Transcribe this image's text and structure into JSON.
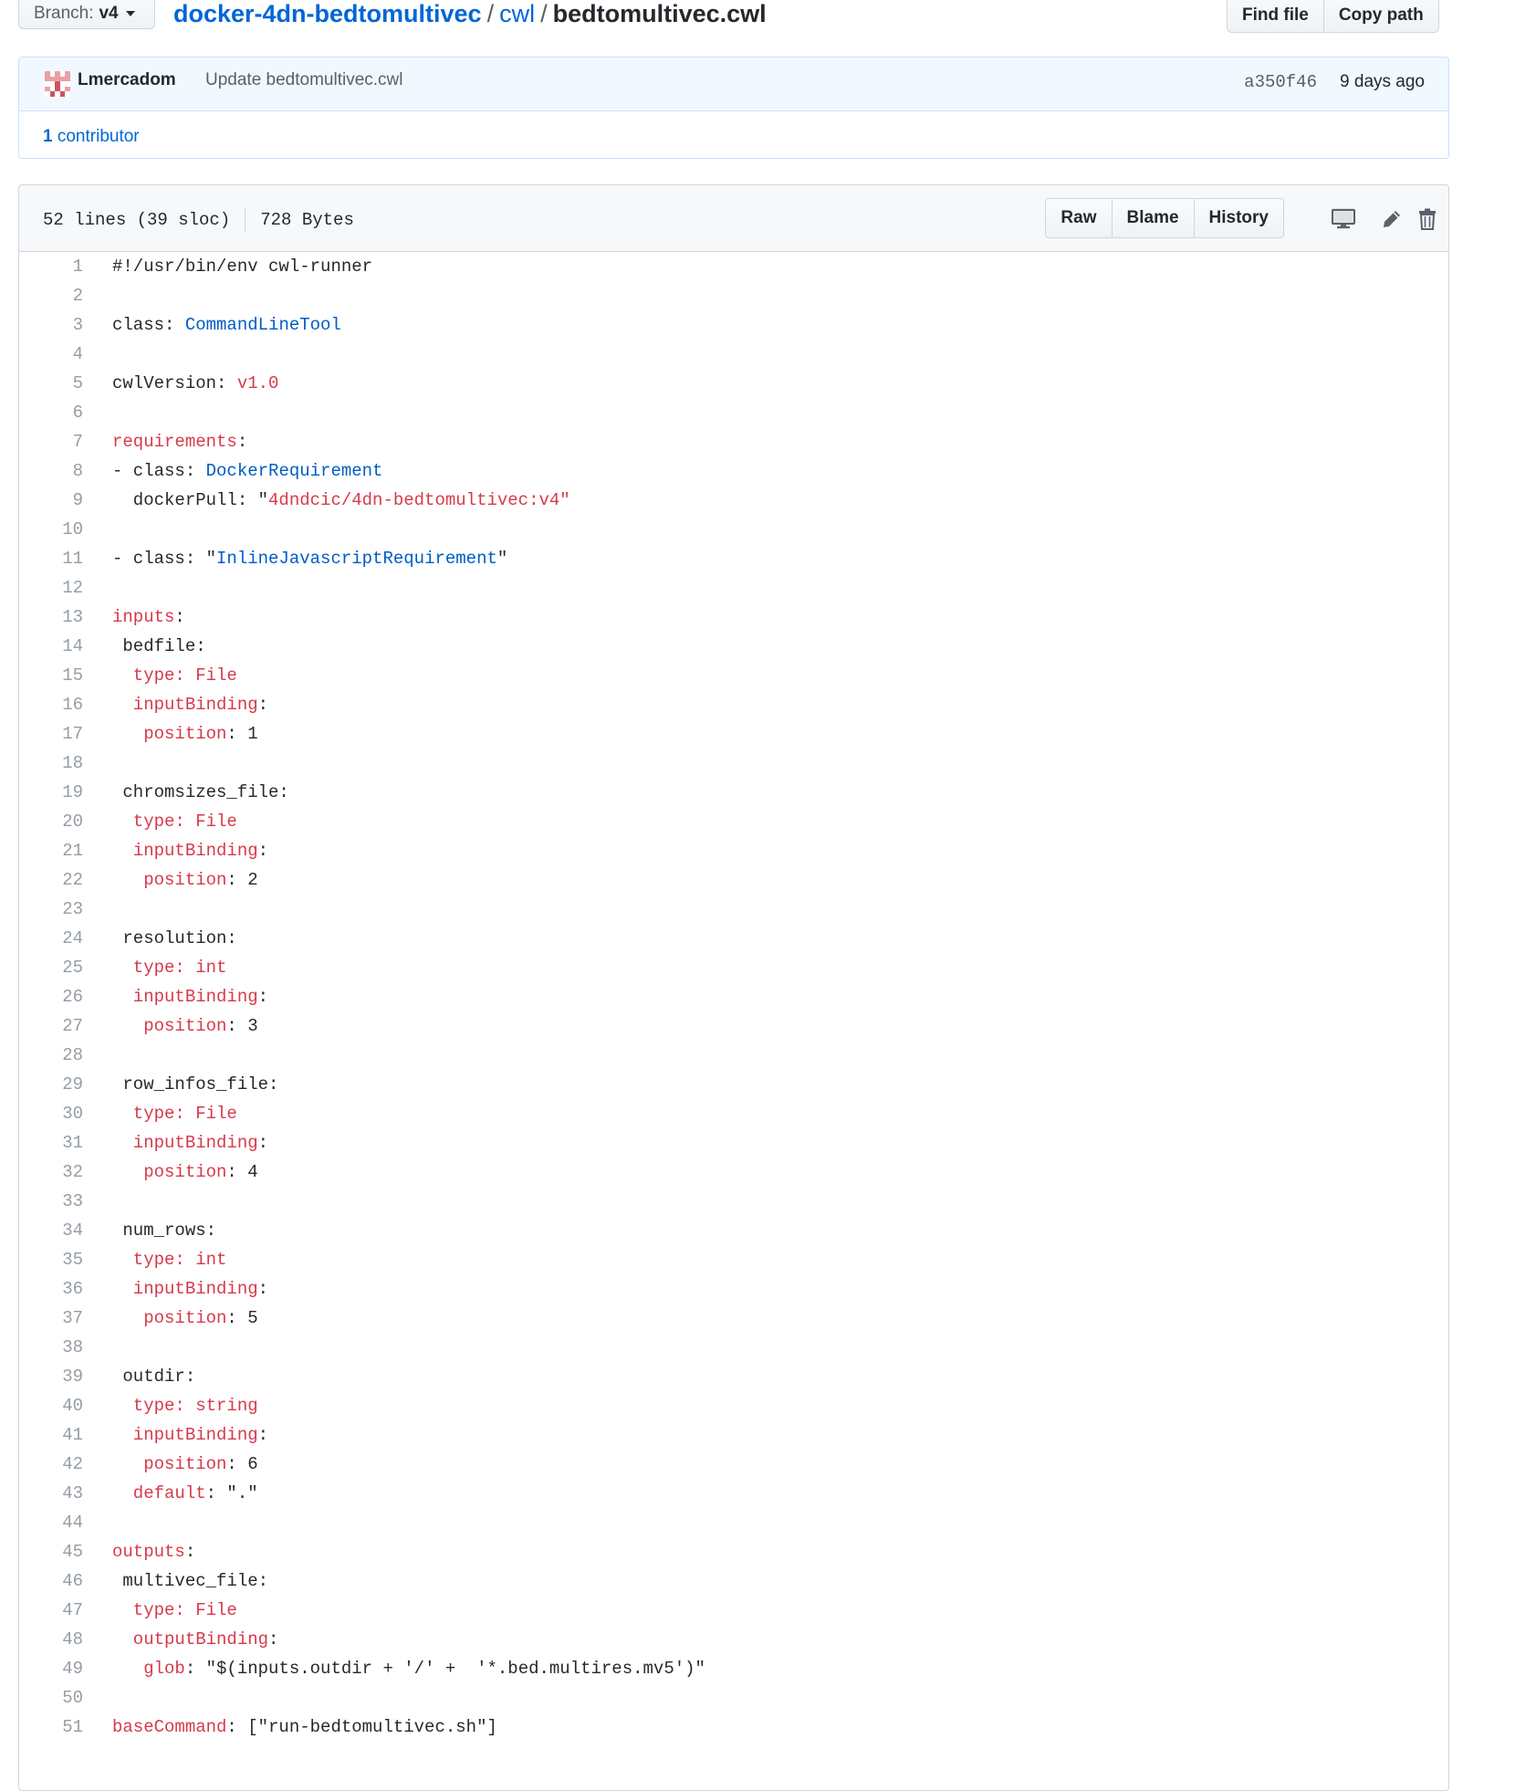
{
  "branch": {
    "label": "Branch:",
    "value": "v4"
  },
  "breadcrumb": {
    "repo": "docker-4dn-bedtomultivec",
    "sep": "/",
    "dir": "cwl",
    "file": "bedtomultivec.cwl"
  },
  "file_nav": {
    "find_file": "Find file",
    "copy_path": "Copy path"
  },
  "commit": {
    "author": "Lmercadom",
    "message": "Update bedtomultivec.cwl",
    "sha": "a350f46",
    "time": "9 days ago"
  },
  "contributors": {
    "count": "1",
    "label": "contributor"
  },
  "file_info": {
    "lines": "52 lines (39 sloc)",
    "size": "728 Bytes"
  },
  "file_actions": {
    "raw": "Raw",
    "blame": "Blame",
    "history": "History"
  },
  "icons": {
    "display": "desktop-icon",
    "edit": "pencil-icon",
    "delete": "trash-icon"
  },
  "colors": {
    "link": "#0366d6",
    "keyword": "#d73a49",
    "constant": "#005cc5",
    "line_number": "#959da5"
  },
  "code_lines": [
    [
      [
        "n",
        "#!/usr/bin/env cwl-runner"
      ]
    ],
    [],
    [
      [
        "n",
        "class: "
      ],
      [
        "c",
        "CommandLineTool"
      ]
    ],
    [],
    [
      [
        "n",
        "cwlVersion: "
      ],
      [
        "s",
        "v1.0"
      ]
    ],
    [],
    [
      [
        "k",
        "requirements"
      ],
      [
        "n",
        ":"
      ]
    ],
    [
      [
        "n",
        "- class: "
      ],
      [
        "c",
        "DockerRequirement"
      ]
    ],
    [
      [
        "n",
        "  dockerPull: \""
      ],
      [
        "s",
        "4dndcic/4dn-bedtomultivec:v4"
      ],
      [
        "s",
        "\""
      ]
    ],
    [],
    [
      [
        "n",
        "- class: \""
      ],
      [
        "c",
        "InlineJavascriptRequirement"
      ],
      [
        "n",
        "\""
      ]
    ],
    [],
    [
      [
        "k",
        "inputs"
      ],
      [
        "n",
        ":"
      ]
    ],
    [
      [
        "n",
        " bedfile:"
      ]
    ],
    [
      [
        "k",
        "  type: File"
      ]
    ],
    [
      [
        "k",
        "  inputBinding"
      ],
      [
        "n",
        ":"
      ]
    ],
    [
      [
        "k",
        "   position"
      ],
      [
        "n",
        ": 1"
      ]
    ],
    [],
    [
      [
        "n",
        " chromsizes_file:"
      ]
    ],
    [
      [
        "k",
        "  type: File"
      ]
    ],
    [
      [
        "k",
        "  inputBinding"
      ],
      [
        "n",
        ":"
      ]
    ],
    [
      [
        "k",
        "   position"
      ],
      [
        "n",
        ": 2"
      ]
    ],
    [],
    [
      [
        "n",
        " resolution:"
      ]
    ],
    [
      [
        "k",
        "  type: int"
      ]
    ],
    [
      [
        "k",
        "  inputBinding"
      ],
      [
        "n",
        ":"
      ]
    ],
    [
      [
        "k",
        "   position"
      ],
      [
        "n",
        ": 3"
      ]
    ],
    [],
    [
      [
        "n",
        " row_infos_file:"
      ]
    ],
    [
      [
        "k",
        "  type: File"
      ]
    ],
    [
      [
        "k",
        "  inputBinding"
      ],
      [
        "n",
        ":"
      ]
    ],
    [
      [
        "k",
        "   position"
      ],
      [
        "n",
        ": 4"
      ]
    ],
    [],
    [
      [
        "n",
        " num_rows:"
      ]
    ],
    [
      [
        "k",
        "  type: int"
      ]
    ],
    [
      [
        "k",
        "  inputBinding"
      ],
      [
        "n",
        ":"
      ]
    ],
    [
      [
        "k",
        "   position"
      ],
      [
        "n",
        ": 5"
      ]
    ],
    [],
    [
      [
        "n",
        " outdir:"
      ]
    ],
    [
      [
        "k",
        "  type: string"
      ]
    ],
    [
      [
        "k",
        "  inputBinding"
      ],
      [
        "n",
        ":"
      ]
    ],
    [
      [
        "k",
        "   position"
      ],
      [
        "n",
        ": 6"
      ]
    ],
    [
      [
        "k",
        "  default"
      ],
      [
        "n",
        ": \".\""
      ]
    ],
    [],
    [
      [
        "k",
        "outputs"
      ],
      [
        "n",
        ":"
      ]
    ],
    [
      [
        "n",
        " multivec_file:"
      ]
    ],
    [
      [
        "k",
        "  type: File"
      ]
    ],
    [
      [
        "k",
        "  outputBinding"
      ],
      [
        "n",
        ":"
      ]
    ],
    [
      [
        "k",
        "   glob"
      ],
      [
        "n",
        ": \"$(inputs.outdir + '/' +  '*.bed.multires.mv5')\""
      ]
    ],
    [],
    [
      [
        "k",
        "baseCommand"
      ],
      [
        "n",
        ": [\"run-bedtomultivec.sh\"]"
      ]
    ]
  ]
}
